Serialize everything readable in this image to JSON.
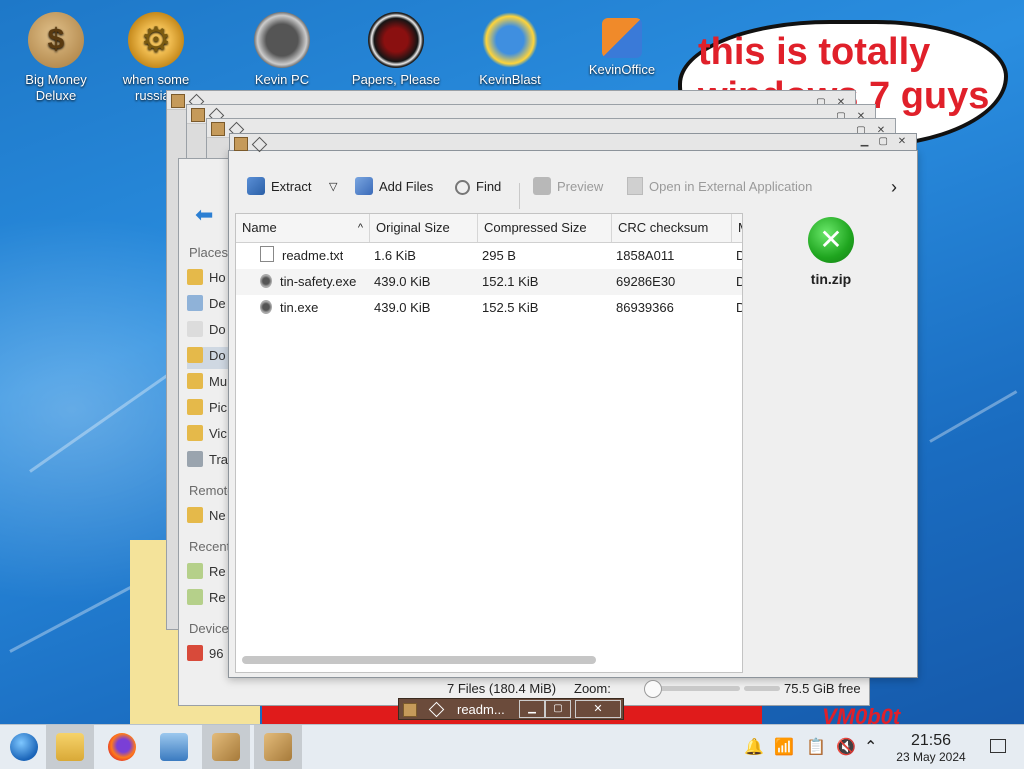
{
  "desktop": {
    "icons": [
      {
        "label": "Big Money Deluxe",
        "icon": "money-bag-icon",
        "color": "#c9a060"
      },
      {
        "label": "when some russian",
        "icon": "gear-icon",
        "color": "#e6a52c"
      },
      {
        "label": "Kevin PC",
        "icon": "speedometer-icon",
        "color": "#6a6a6a"
      },
      {
        "label": "Papers, Please",
        "icon": "papers-please-icon",
        "color": "#1a1a1a"
      },
      {
        "label": "KevinBlast",
        "icon": "globe-icon",
        "color": "#3a8ce0"
      },
      {
        "label": "KevinOffice",
        "icon": "office-icon",
        "color": "#e86b1f"
      }
    ],
    "note": "this is totally windows 7 guys",
    "vm_text": "VM0b0t"
  },
  "ark": {
    "toolbar": {
      "extract": "Extract",
      "add_files": "Add Files",
      "find": "Find",
      "preview": "Preview",
      "open_external": "Open in External Application"
    },
    "columns": [
      "Name",
      "Original Size",
      "Compressed Size",
      "CRC checksum",
      "M"
    ],
    "files": [
      {
        "name": "readme.txt",
        "original": "1.6 KiB",
        "compressed": "295 B",
        "crc": "1858A011",
        "m": "D"
      },
      {
        "name": "tin-safety.exe",
        "original": "439.0 KiB",
        "compressed": "152.1 KiB",
        "crc": "69286E30",
        "m": "D"
      },
      {
        "name": "tin.exe",
        "original": "439.0 KiB",
        "compressed": "152.5 KiB",
        "crc": "86939366",
        "m": "D"
      }
    ],
    "archive_name": "tin.zip"
  },
  "dolphin": {
    "sections": {
      "places": "Places",
      "remote": "Remote",
      "recent": "Recent",
      "devices": "Devices"
    },
    "items": [
      "Ho",
      "De",
      "Do",
      "Do",
      "Mu",
      "Pic",
      "Vic",
      "Tra",
      "Ne",
      "Re",
      "Re",
      "96"
    ]
  },
  "status": {
    "files": "7 Files (180.4 MiB)",
    "zoom": "Zoom:",
    "free": "75.5 GiB free"
  },
  "float_window": {
    "title": "readm..."
  },
  "taskbar": {
    "time": "21:56",
    "date": "23 May 2024"
  }
}
